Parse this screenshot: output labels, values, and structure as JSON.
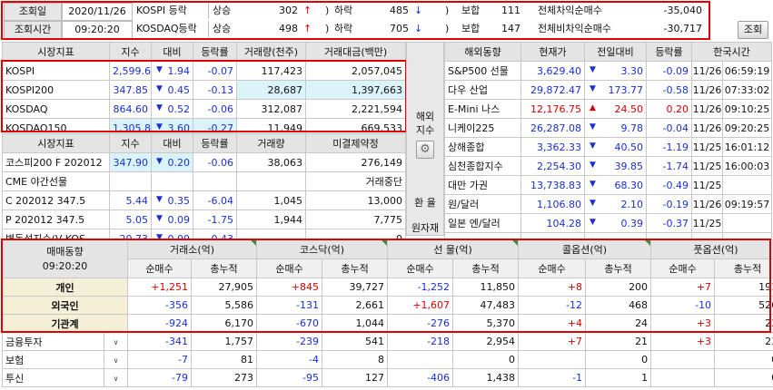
{
  "top": {
    "date_label": "조회일",
    "date_value": "2020/11/26",
    "time_label": "조회시간",
    "time_value": "09:20:20",
    "rows": [
      {
        "market": "KOSPI 등락",
        "up_label": "상승",
        "up_value": "302",
        "up_arrow": "↑",
        "down_label": "하락",
        "down_value": "485",
        "down_arrow": "↓",
        "flat_label": "보합",
        "flat_value": "111",
        "diff_label": "전체차익순매수",
        "diff_value": "-35,040"
      },
      {
        "market": "KOSDAQ등락",
        "up_label": "상승",
        "up_value": "498",
        "up_arrow": "↑",
        "down_label": "하락",
        "down_value": "705",
        "down_arrow": "↓",
        "flat_label": "보합",
        "flat_value": "147",
        "diff_label": "전체비차익순매수",
        "diff_value": "-30,717"
      }
    ],
    "search_button": "조회"
  },
  "left_index": {
    "headers": [
      "시장지표",
      "지수",
      "대비",
      "등락률",
      "거래량(천주)",
      "거래대금(백만)"
    ],
    "rows": [
      {
        "name": "KOSPI",
        "index": "2,599.60",
        "arrow": "▼",
        "change": "1.94",
        "rate": "-0.07",
        "volume": "117,423",
        "amount": "2,057,045"
      },
      {
        "name": "KOSPI200",
        "index": "347.85",
        "arrow": "▼",
        "change": "0.45",
        "rate": "-0.13",
        "volume": "28,687",
        "amount": "1,397,663"
      },
      {
        "name": "KOSDAQ",
        "index": "864.60",
        "arrow": "▼",
        "change": "0.52",
        "rate": "-0.06",
        "volume": "312,087",
        "amount": "2,221,594"
      },
      {
        "name": "KOSDAQ150",
        "index": "1,305.86",
        "arrow": "▼",
        "change": "3.60",
        "rate": "-0.27",
        "volume": "11,949",
        "amount": "669,533"
      }
    ]
  },
  "left_futures": {
    "headers": [
      "시장지표",
      "지수",
      "대비",
      "등락률",
      "거래량",
      "미결제약정"
    ],
    "rows": [
      {
        "name": "코스피200 F 202012",
        "index": "347.90",
        "arrow": "▼",
        "change": "0.20",
        "rate": "-0.06",
        "volume": "38,063",
        "oi": "276,149"
      },
      {
        "name": "CME 야간선물",
        "index": "",
        "arrow": "",
        "change": "",
        "rate": "",
        "volume": "",
        "oi": "거래중단"
      },
      {
        "name": "C 202012 347.5",
        "index": "5.44",
        "arrow": "▼",
        "change": "0.35",
        "rate": "-6.04",
        "volume": "1,045",
        "oi": "13,000"
      },
      {
        "name": "P 202012 347.5",
        "index": "5.05",
        "arrow": "▼",
        "change": "0.09",
        "rate": "-1.75",
        "volume": "1,944",
        "oi": "7,775"
      },
      {
        "name": "변동성지수(V-KOS",
        "index": "20.73",
        "arrow": "▼",
        "change": "0.09",
        "rate": "-0.43",
        "volume": "",
        "oi": "0"
      }
    ]
  },
  "middle": {
    "overseas_label": "해외지수",
    "gear": "⚙",
    "fx_label1": "환 율",
    "fx_label2": "원자재"
  },
  "right_overseas": {
    "headers": [
      "해외동향",
      "현재가",
      "전일대비",
      "등락률",
      "한국시간"
    ],
    "rows": [
      {
        "name": "S&P500 선물",
        "price": "3,629.40",
        "arrow": "▼",
        "change": "3.30",
        "rate": "-0.09",
        "date": "11/26",
        "time": "06:59:19",
        "dir": "dn"
      },
      {
        "name": "다우 산업",
        "price": "29,872.47",
        "arrow": "▼",
        "change": "173.77",
        "rate": "-0.58",
        "date": "11/26",
        "time": "07:33:02",
        "dir": "dn"
      },
      {
        "name": "E-Mini 나스",
        "price": "12,176.75",
        "arrow": "▲",
        "change": "24.50",
        "rate": "0.20",
        "date": "11/26",
        "time": "09:10:25",
        "dir": "up"
      },
      {
        "name": "니케이225",
        "price": "26,287.08",
        "arrow": "▼",
        "change": "9.78",
        "rate": "-0.04",
        "date": "11/26",
        "time": "09:20:25",
        "dir": "dn"
      },
      {
        "name": "상해종합",
        "price": "3,362.33",
        "arrow": "▼",
        "change": "40.50",
        "rate": "-1.19",
        "date": "11/25",
        "time": "16:01:12",
        "dir": "dn"
      },
      {
        "name": "심천종합지수",
        "price": "2,254.30",
        "arrow": "▼",
        "change": "39.85",
        "rate": "-1.74",
        "date": "11/25",
        "time": "16:00:03",
        "dir": "dn"
      },
      {
        "name": "대만 가권",
        "price": "13,738.83",
        "arrow": "▼",
        "change": "68.30",
        "rate": "-0.49",
        "date": "11/25",
        "time": "",
        "dir": "dn"
      },
      {
        "name": "원/달러",
        "price": "1,106.80",
        "arrow": "▼",
        "change": "2.10",
        "rate": "-0.19",
        "date": "11/26",
        "time": "09:19:57",
        "dir": "dn"
      },
      {
        "name": "일본 엔/달러",
        "price": "104.28",
        "arrow": "▼",
        "change": "0.39",
        "rate": "-0.37",
        "date": "11/25",
        "time": "",
        "dir": "dn"
      },
      {
        "name": "WTI 21-01",
        "price": "45.74",
        "arrow": "▲",
        "change": "0.03",
        "rate": "0.07",
        "date": "11/26",
        "time": "09:10:24",
        "dir": "up"
      }
    ]
  },
  "trade": {
    "title": "매매동향",
    "time": "09:20:20",
    "groups": [
      "거래소(억)",
      "코스닥(억)",
      "선 물(억)",
      "콜옵션(억)",
      "풋옵션(억)"
    ],
    "sub": [
      "순매수",
      "총누적"
    ],
    "rows": [
      {
        "name": "개인",
        "vals": [
          "+1,251",
          "27,905",
          "+845",
          "39,727",
          "-1,252",
          "11,850",
          "+8",
          "200",
          "+7",
          "191"
        ],
        "highlight": true
      },
      {
        "name": "외국인",
        "vals": [
          "-356",
          "5,586",
          "-131",
          "2,661",
          "+1,607",
          "47,483",
          "-12",
          "468",
          "-10",
          "526"
        ],
        "highlight": true
      },
      {
        "name": "기관계",
        "vals": [
          "-924",
          "6,170",
          "-670",
          "1,044",
          "-276",
          "5,370",
          "+4",
          "24",
          "+3",
          "23"
        ],
        "highlight": true
      },
      {
        "name": "금융투자",
        "vals": [
          "-341",
          "1,757",
          "-239",
          "541",
          "-218",
          "2,954",
          "+7",
          "21",
          "+3",
          "23"
        ],
        "highlight": false
      },
      {
        "name": "보험",
        "vals": [
          "-7",
          "81",
          "-4",
          "8",
          "",
          "0",
          "",
          "0",
          "",
          "0"
        ],
        "highlight": false
      },
      {
        "name": "투신",
        "vals": [
          "-79",
          "273",
          "-95",
          "127",
          "-406",
          "1,438",
          "-1",
          "1",
          "",
          "0"
        ],
        "highlight": false
      }
    ]
  }
}
